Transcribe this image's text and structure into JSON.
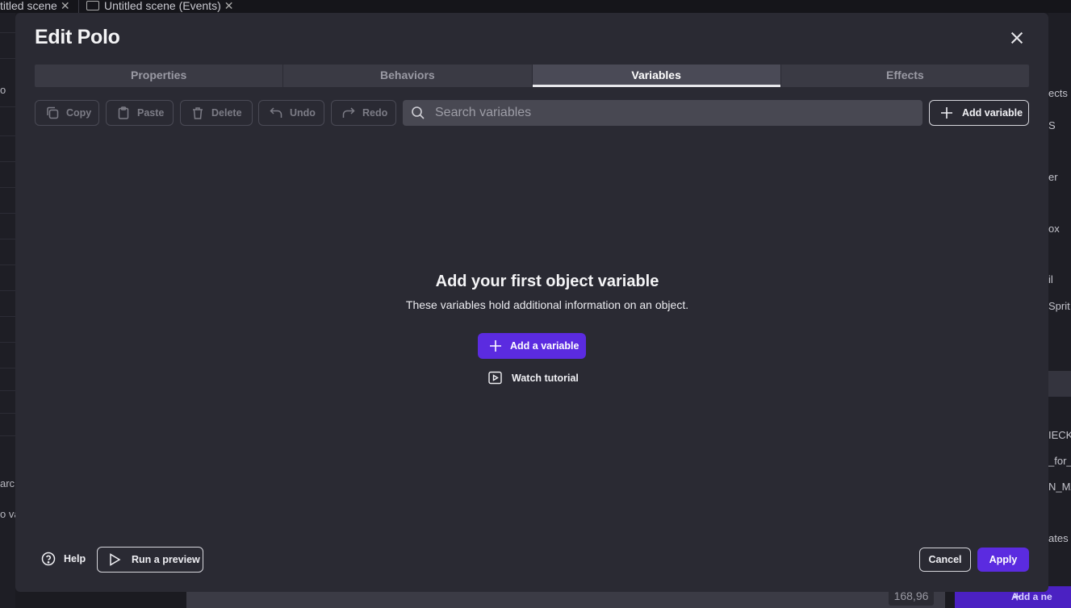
{
  "background": {
    "tabs": [
      {
        "label": "titled scene"
      },
      {
        "label": "Untitled scene (Events)"
      }
    ],
    "left_fragments": [
      "o",
      "arc",
      "o va"
    ],
    "right_fragments": [
      "ects",
      "S",
      "er",
      "ox",
      "il",
      "Sprit",
      "IECK",
      "_for_(",
      "N_MA",
      "ates"
    ],
    "coord_readout": "168,96",
    "add_new_label": "Add a ne"
  },
  "dialog": {
    "title": "Edit Polo",
    "tabs": [
      {
        "label": "Properties",
        "active": false
      },
      {
        "label": "Behaviors",
        "active": false
      },
      {
        "label": "Variables",
        "active": true
      },
      {
        "label": "Effects",
        "active": false
      }
    ],
    "toolbar": {
      "copy": "Copy",
      "paste": "Paste",
      "delete": "Delete",
      "undo": "Undo",
      "redo": "Redo",
      "search_placeholder": "Search variables",
      "add_variable": "Add variable"
    },
    "empty_state": {
      "heading": "Add your first object variable",
      "description": "These variables hold additional information on an object.",
      "primary_action": "Add a variable",
      "tutorial_link": "Watch tutorial"
    },
    "footer": {
      "help": "Help",
      "run_preview": "Run a preview",
      "cancel": "Cancel",
      "apply": "Apply"
    }
  },
  "colors": {
    "accent": "#5b2be0",
    "dialog_bg": "#2a2a33",
    "backdrop": "#1b1b21"
  }
}
